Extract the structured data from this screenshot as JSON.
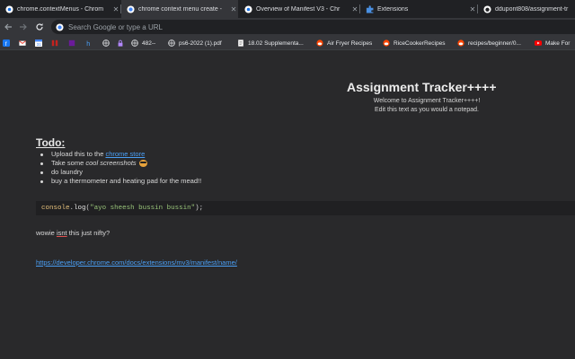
{
  "tabs": [
    {
      "title": "chrome.contextMenus - Chrom",
      "icon": "chrome-developers-icon",
      "active": false
    },
    {
      "title": "chrome context menu create -",
      "icon": "google-icon",
      "active": true
    },
    {
      "title": "Overview of Manifest V3 - Chr",
      "icon": "chrome-developers-icon",
      "active": false
    },
    {
      "title": "Extensions",
      "icon": "puzzle-piece-icon",
      "active": false
    },
    {
      "title": "ddupont808/assignment-tr",
      "icon": "github-icon",
      "active": false
    }
  ],
  "omnibox": {
    "placeholder": "Search Google or type a URL"
  },
  "bookmarks": [
    {
      "label": "",
      "icon": "facebook-icon"
    },
    {
      "label": "",
      "icon": "gmail-icon"
    },
    {
      "label": "",
      "icon": "calendar-icon"
    },
    {
      "label": "",
      "icon": "red-app-icon"
    },
    {
      "label": "",
      "icon": "purple-app-icon"
    },
    {
      "label": "",
      "icon": "h-app-icon"
    },
    {
      "label": "",
      "icon": "globe-icon"
    },
    {
      "label": "",
      "icon": "lock-icon"
    },
    {
      "label": "482--",
      "icon": "globe-icon"
    },
    {
      "label": "ps6-2022 (1).pdf",
      "icon": "globe-icon"
    },
    {
      "label": "18.02 Supplementa...",
      "icon": "document-icon"
    },
    {
      "label": "Air Fryer Recipes",
      "icon": "reddit-icon"
    },
    {
      "label": "RiceCookerRecipes",
      "icon": "reddit-icon"
    },
    {
      "label": "recipes/beginner/0...",
      "icon": "reddit-icon"
    },
    {
      "label": "Make For",
      "icon": "youtube-icon"
    }
  ],
  "page": {
    "title": "Assignment Tracker++++",
    "intro_line1": "Welcome to Assignment Tracker++++!",
    "intro_line2": "Edit this text as you would a notepad.",
    "todo_heading": "Todo:",
    "todo": {
      "item1_prefix": "Upload this to the",
      "item1_link": "chrome store",
      "item2_prefix": "Take some",
      "item2_italic": "cool screenshots",
      "item3": "do laundry",
      "item4": "buy a thermometer and heating pad for the mead!!"
    },
    "code": {
      "ident": "console",
      "dot": ".",
      "fn": "log",
      "open": "(",
      "string": "\"ayo sheesh bussin bussin\"",
      "close": ");"
    },
    "paragraph_pre": "wowie ",
    "paragraph_underlined": "isnt",
    "paragraph_post": " this just nifty?",
    "link": "https://developer.chrome.com/docs/extensions/mv3/manifest/name/"
  },
  "colors": {
    "background": "#29292b",
    "link": "#4a9ff5",
    "code_string": "#98c379",
    "code_ident": "#e5c07b"
  }
}
